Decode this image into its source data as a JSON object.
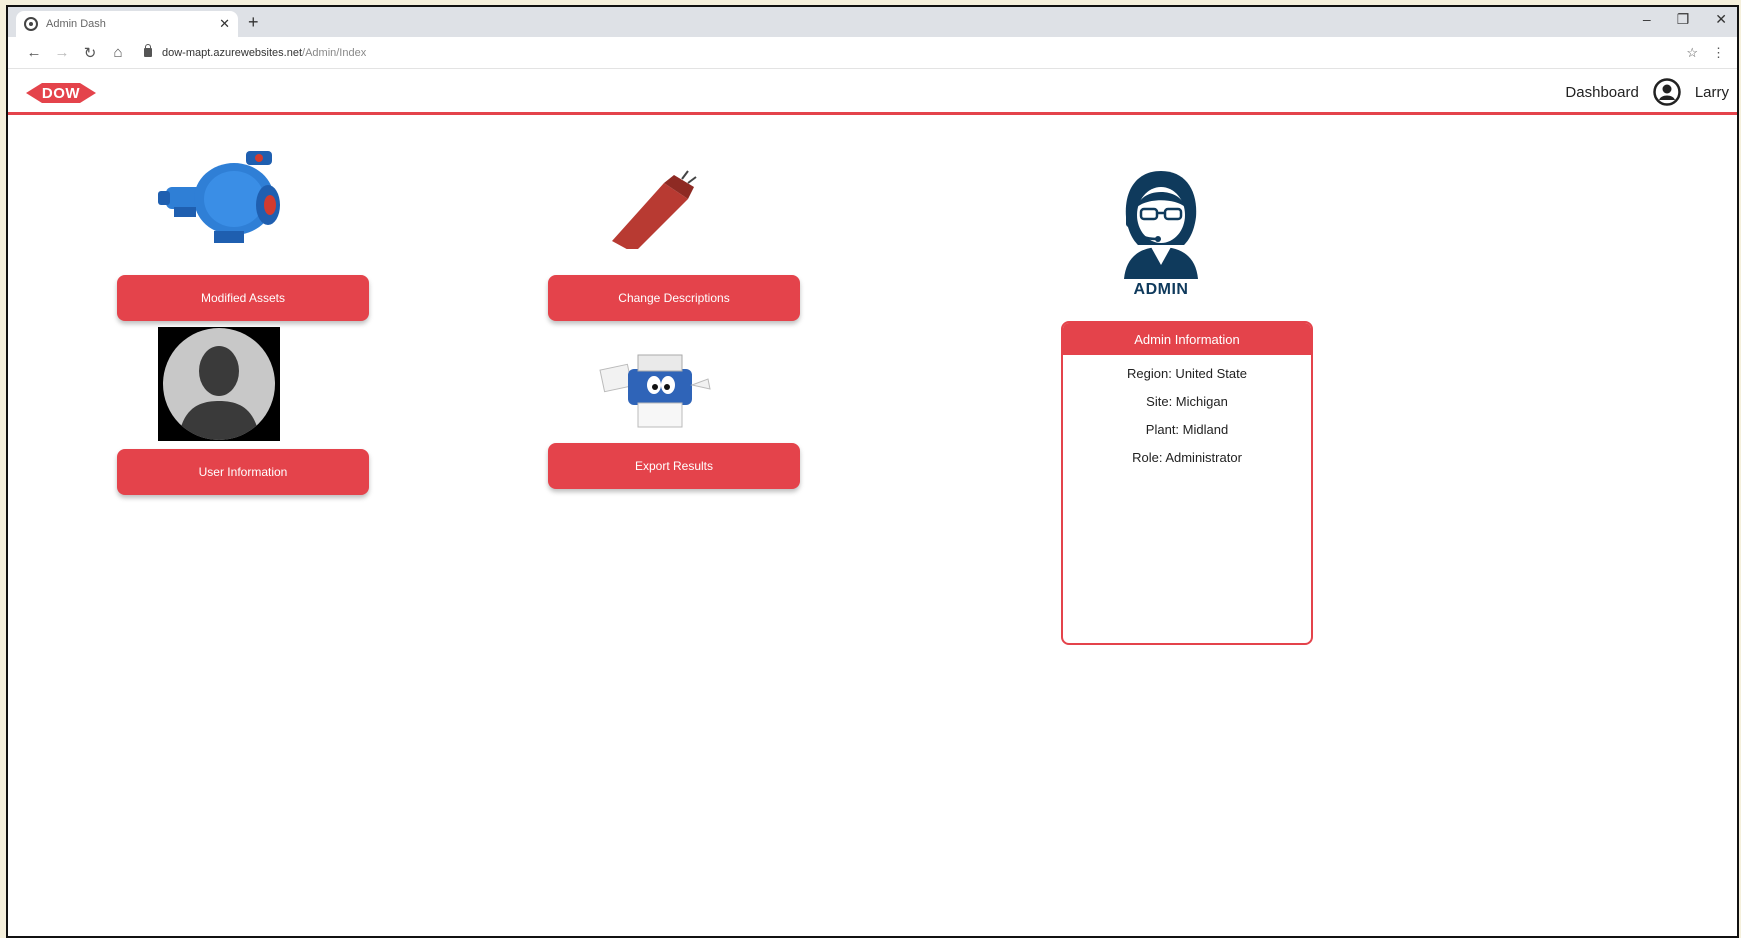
{
  "browser": {
    "tab_title": "Admin Dash",
    "url_host": "dow-mapt.azurewebsites.net",
    "url_path": "/Admin/Index"
  },
  "header": {
    "logo_text": "DOW",
    "dashboard_label": "Dashboard",
    "user_name": "Larry"
  },
  "tiles": {
    "modified_assets_label": "Modified Assets",
    "user_information_label": "User Information",
    "change_descriptions_label": "Change Descriptions",
    "export_results_label": "Export Results"
  },
  "admin": {
    "avatar_label": "ADMIN",
    "card_title": "Admin Information",
    "region": "Region: United State",
    "site": "Site: Michigan",
    "plant": "Plant: Midland",
    "role": "Role: Administrator"
  },
  "colors": {
    "brand_red": "#e4434b",
    "admin_blue": "#0f3a5c",
    "pump_blue": "#2f7fd6"
  }
}
